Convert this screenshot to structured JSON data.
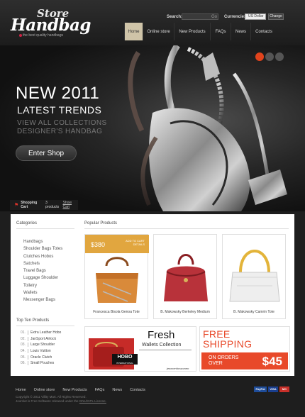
{
  "logo": {
    "store": "Store",
    "handbag": "Handbag",
    "tagline": "the best quality handbags"
  },
  "header": {
    "search_label": "Search:",
    "search_go": "Go",
    "currencies_label": "Currencies:",
    "currency_value": "US Dollar",
    "change_label": "Change"
  },
  "nav": [
    {
      "label": "Home",
      "active": true
    },
    {
      "label": "Online store"
    },
    {
      "label": "New Products"
    },
    {
      "label": "FAQs"
    },
    {
      "label": "News"
    },
    {
      "label": "Contacts"
    }
  ],
  "hero": {
    "title1": "NEW 2011",
    "title2": "LATEST TRENDS",
    "sub1": "VIEW ALL COLLECTIONS",
    "sub2": "DESIGNER'S HANDBAG",
    "button": "Enter Shop",
    "accent": "#e0431c"
  },
  "cart": {
    "label": "Shopping Cart",
    "count": "3 products",
    "link": "Show Cart"
  },
  "categories": {
    "title": "Categories",
    "items": [
      "Handbags",
      "Shoulder Bags Totes",
      "Clutches Hobos",
      "Satchels",
      "Travel Bags",
      "Luggage Shoulder",
      "Toiletry",
      "Wallets",
      "Messenger Bags"
    ]
  },
  "top_ten": {
    "title": "Top Ten Products",
    "items": [
      {
        "num": "01.",
        "name": "Extra Leather Hobo"
      },
      {
        "num": "02.",
        "name": "JanSport Airlock"
      },
      {
        "num": "03.",
        "name": "Large Shoulder"
      },
      {
        "num": "04.",
        "name": "Louis Vuitton"
      },
      {
        "num": "05.",
        "name": "Oracle Clutch"
      },
      {
        "num": "06.",
        "name": "Small Pouches"
      }
    ]
  },
  "popular": {
    "title": "Popular Products",
    "price": "$380",
    "add_to_cart": "ADD TO CART",
    "details": "DETAILS",
    "products": [
      {
        "name": "Francesca Bisola Genoa Tote"
      },
      {
        "name": "B. Makowsky Berkeley Medium"
      },
      {
        "name": "B. Makowsky Camrin Tote"
      }
    ]
  },
  "banner_wallets": {
    "title": "Fresh",
    "subtitle": "Wallets Collection",
    "brand": "HOBO",
    "brand_sub": "INTERNATIONAL",
    "url": "jewmenforwomen"
  },
  "banner_shipping": {
    "line1": "FREE",
    "line2": "SHIPPING",
    "on1": "ON ORDERS",
    "on2": "OVER",
    "amount": "$45"
  },
  "footer": {
    "nav": [
      "Home",
      "Online store",
      "New Products",
      "FAQs",
      "News",
      "Contacts"
    ],
    "copy1": "Copyright © 2011 Villity Mart. All Rights Reserved.",
    "copy2a": "Joomla! is Free Software released under the ",
    "copy2b": "GNU/GPL License.",
    "payments": [
      "PayPal",
      "VISA",
      "MC"
    ]
  }
}
